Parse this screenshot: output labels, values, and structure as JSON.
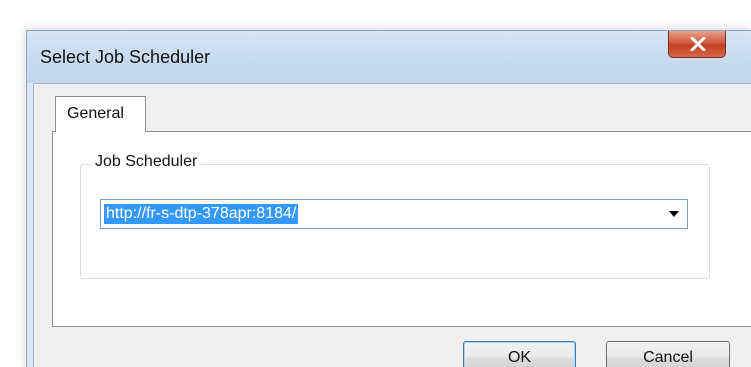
{
  "window": {
    "title": "Select Job Scheduler"
  },
  "icons": {
    "close": "close-icon",
    "dropdown": "chevron-down-icon"
  },
  "colors": {
    "close_button": "#c8482b",
    "selection": "#3399ff",
    "title_bar": "#c9dbef"
  },
  "tabs": [
    {
      "label": "General",
      "selected": true
    }
  ],
  "job_scheduler": {
    "group_label": "Job Scheduler",
    "selected_value": "http://fr-s-dtp-378apr:8184/"
  },
  "buttons": {
    "ok": "OK",
    "cancel": "Cancel"
  }
}
